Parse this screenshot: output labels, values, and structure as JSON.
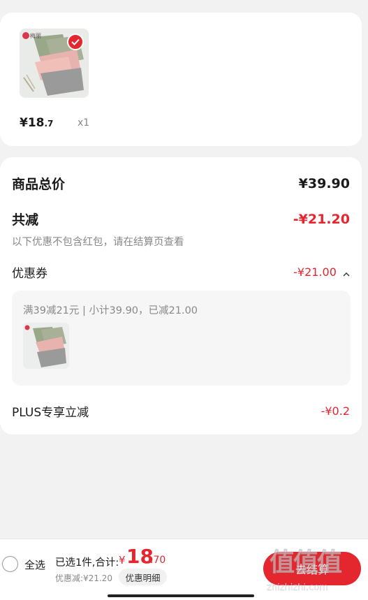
{
  "product": {
    "price_int": "¥18",
    "price_dec": ".7",
    "quantity": "x1",
    "brand_mark": "梅丽"
  },
  "summary": {
    "total_label": "商品总价",
    "total_value": "¥39.90",
    "reduce_label": "共减",
    "reduce_value": "-¥21.20",
    "note": "以下优惠不包含红包，请在结算页查看",
    "coupon_label": "优惠券",
    "coupon_value": "-¥21.00",
    "coupon_detail": "满39减21元 | 小计39.90，已减21.00",
    "plus_label": "PLUS专享立减",
    "plus_value": "-¥0.2"
  },
  "bottom": {
    "select_all": "全选",
    "selected_text": "已选1件,合计:",
    "total_yen": "¥",
    "total_int": "18",
    "total_dec": ".70",
    "discount_text": "优惠减:¥21.20",
    "detail_button": "优惠明细",
    "checkout_button": "去结算"
  },
  "watermark": {
    "text": "值值值",
    "domain": "zhizhizhi.com"
  },
  "colors": {
    "accent": "#e4262f",
    "muted": "#888888",
    "background": "#f2f2f2"
  }
}
